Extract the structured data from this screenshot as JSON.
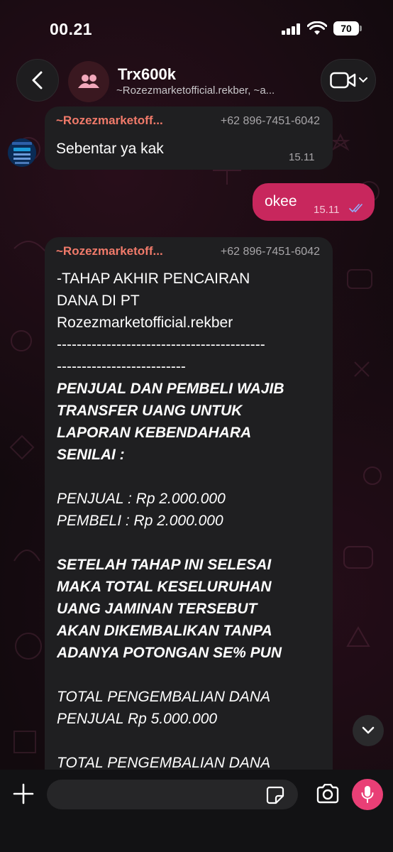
{
  "status_bar": {
    "time": "00.21",
    "battery": "70"
  },
  "header": {
    "title": "Trx600k",
    "subtitle": "~Rozezmarketofficial.rekber, ~a..."
  },
  "messages": [
    {
      "sender": "~Rozezmarketoff...",
      "phone": "+62 896-7451-6042",
      "text": "Sebentar ya kak",
      "time": "15.11"
    },
    {
      "text": "okee",
      "time": "15.11",
      "status": "read"
    },
    {
      "sender": "~Rozezmarketoff...",
      "phone": "+62 896-7451-6042",
      "lines": {
        "l1": "-TAHAP AKHIR PENCAIRAN",
        "l2": "DANA DI PT",
        "l3": "Rozezmarketofficial.rekber",
        "l4": "------------------------------------------",
        "l5": "--------------------------",
        "l6": "PENJUAL DAN PEMBELI WAJIB",
        "l7": "TRANSFER UANG UNTUK",
        "l8": "LAPORAN KEBENDAHARA",
        "l9": "SENILAI :",
        "l10": "PENJUAL : Rp 2.000.000",
        "l11": "PEMBELI : Rp 2.000.000",
        "l12": "SETELAH TAHAP INI SELESAI",
        "l13": "MAKA TOTAL KESELURUHAN",
        "l14": "UANG JAMINAN TERSEBUT",
        "l15": "AKAN DIKEMBALIKAN TANPA",
        "l16": "ADANYA POTONGAN SE% PUN",
        "l17": "TOTAL PENGEMBALIAN DANA",
        "l18": "PENJUAL Rp 5.000.000",
        "l19": "TOTAL PENGEMBALIAN DANA"
      }
    }
  ],
  "input": {
    "placeholder": ""
  },
  "colors": {
    "accent": "#c8275d",
    "mic": "#e93f76",
    "sender_name": "#f07a6a",
    "incoming_bubble": "#1f1f21",
    "read_ticks": "#8fb2ff"
  },
  "icons": {
    "back": "chevron-left-icon",
    "group": "group-icon",
    "video": "video-camera-icon",
    "scroll": "chevron-down-icon",
    "plus": "plus-icon",
    "sticker": "sticker-icon",
    "camera": "camera-icon",
    "mic": "microphone-icon"
  }
}
